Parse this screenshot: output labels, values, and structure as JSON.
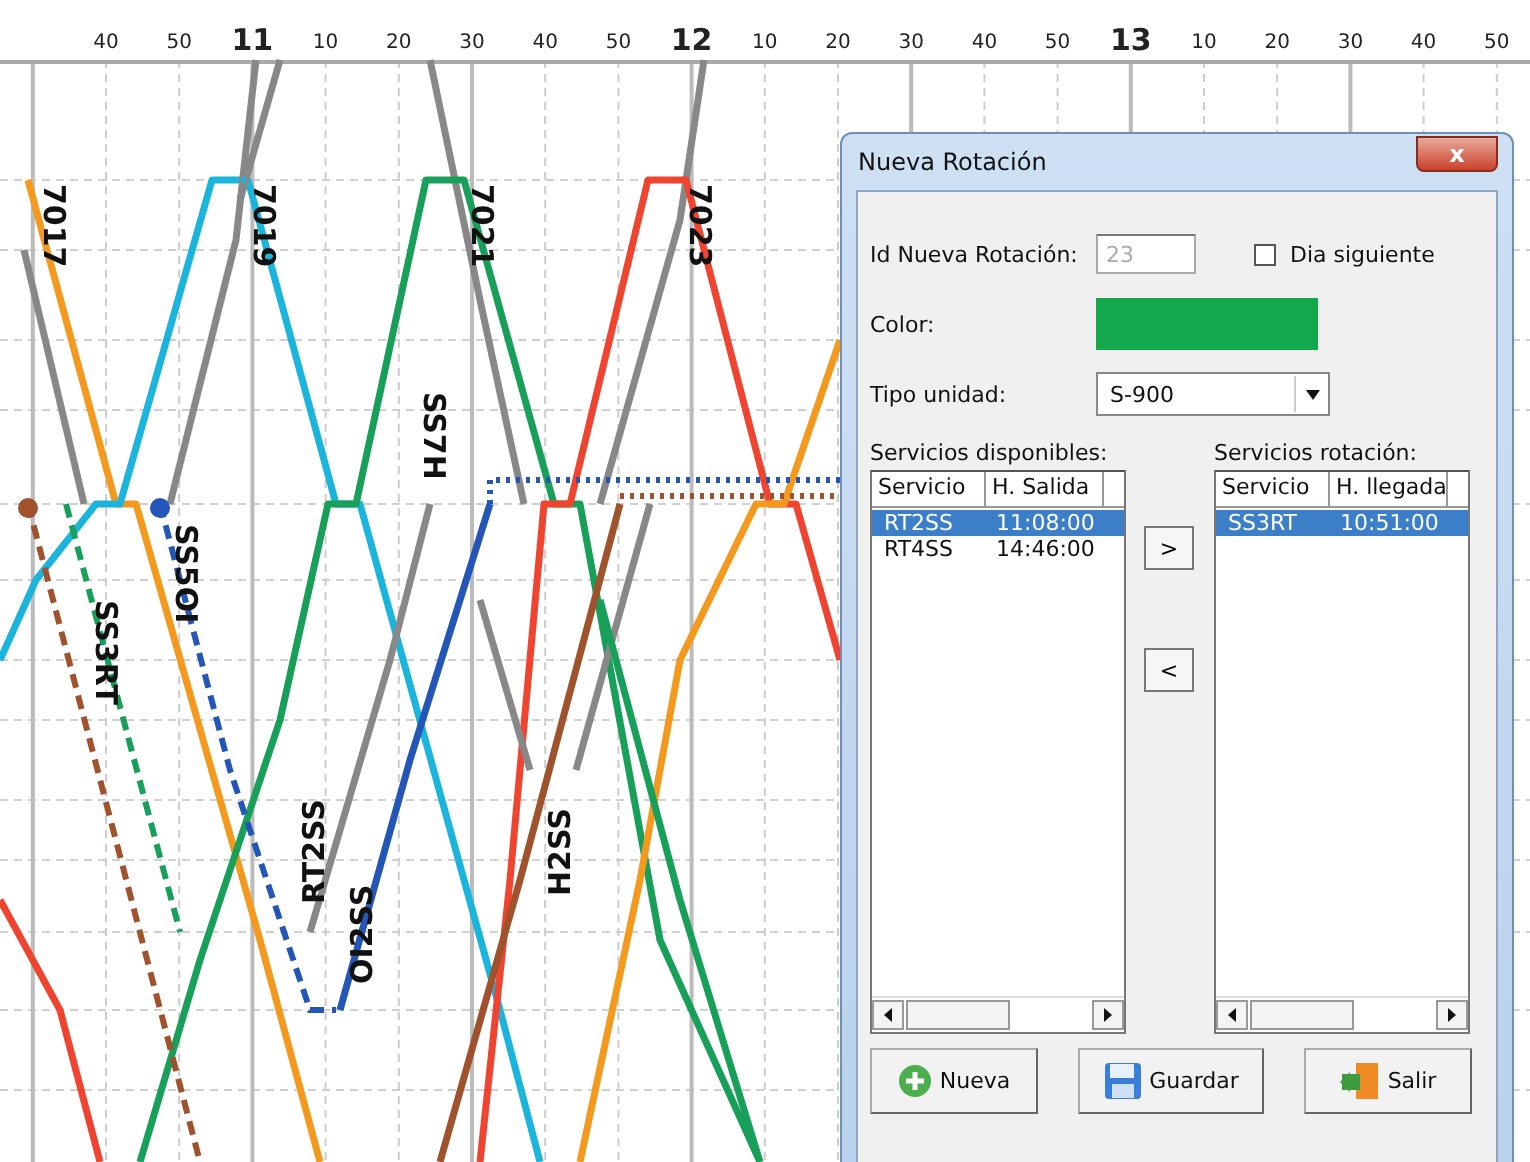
{
  "axis": {
    "ticks": [
      {
        "label": "40",
        "major": false
      },
      {
        "label": "50",
        "major": false
      },
      {
        "label": "11",
        "major": true
      },
      {
        "label": "10",
        "major": false
      },
      {
        "label": "20",
        "major": false
      },
      {
        "label": "30",
        "major": false
      },
      {
        "label": "40",
        "major": false
      },
      {
        "label": "50",
        "major": false
      },
      {
        "label": "12",
        "major": true
      },
      {
        "label": "10",
        "major": false
      },
      {
        "label": "20",
        "major": false
      },
      {
        "label": "30",
        "major": false
      },
      {
        "label": "40",
        "major": false
      },
      {
        "label": "50",
        "major": false
      },
      {
        "label": "13",
        "major": true
      },
      {
        "label": "10",
        "major": false
      },
      {
        "label": "20",
        "major": false
      },
      {
        "label": "30",
        "major": false
      },
      {
        "label": "40",
        "major": false
      },
      {
        "label": "50",
        "major": false
      }
    ]
  },
  "train_labels": [
    "7017",
    "7019",
    "7021",
    "7023",
    "SS7H",
    "SS5OI",
    "SS3RT",
    "RT2SS",
    "OI2SS",
    "H2SS"
  ],
  "dialog": {
    "title": "Nueva Rotación",
    "close": "x",
    "id_label": "Id Nueva Rotación:",
    "id_value": "23",
    "id_disabled": true,
    "next_day": {
      "label": "Dia siguiente",
      "checked": false
    },
    "color_label": "Color:",
    "color": "#13a84b",
    "unit_label": "Tipo unidad:",
    "unit_value": "S-900",
    "available": {
      "title": "Servicios disponibles:",
      "columns": [
        "Servicio",
        "H. Salida"
      ],
      "rows": [
        {
          "cells": [
            "RT2SS",
            "11:08:00"
          ],
          "selected": true
        },
        {
          "cells": [
            "RT4SS",
            "14:46:00"
          ],
          "selected": false
        }
      ]
    },
    "add_button": ">",
    "remove_button": "<",
    "rotation": {
      "title": "Servicios rotación:",
      "columns": [
        "Servicio",
        "H. llegada"
      ],
      "rows": [
        {
          "cells": [
            "SS3RT",
            "10:51:00"
          ],
          "selected": true
        }
      ]
    },
    "buttons": [
      {
        "label": "Nueva",
        "kind": "new"
      },
      {
        "label": "Guardar",
        "kind": "save"
      },
      {
        "label": "Salir",
        "kind": "exit"
      }
    ]
  }
}
